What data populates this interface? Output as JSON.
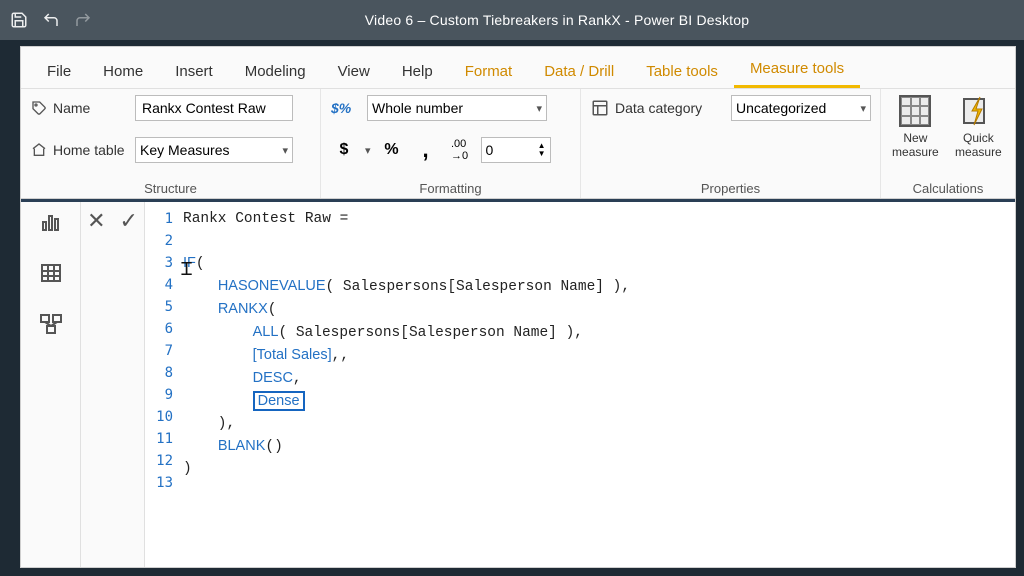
{
  "titlebar": {
    "title": "Video 6 – Custom Tiebreakers in RankX - Power BI Desktop"
  },
  "tabs": {
    "file": "File",
    "home": "Home",
    "insert": "Insert",
    "modeling": "Modeling",
    "view": "View",
    "help": "Help",
    "format": "Format",
    "data_drill": "Data / Drill",
    "table_tools": "Table tools",
    "measure_tools": "Measure tools"
  },
  "ribbon": {
    "structure": {
      "label": "Structure",
      "name_label": "Name",
      "name_value": "Rankx Contest Raw",
      "home_table_label": "Home table",
      "home_table_value": "Key Measures"
    },
    "formatting": {
      "label": "Formatting",
      "format_value": "Whole number",
      "decimals": "0",
      "currency_btn": "$",
      "percent_btn": "%",
      "comma_btn": ",",
      "decimal_btn": ".00→0"
    },
    "properties": {
      "label": "Properties",
      "data_category_label": "Data category",
      "data_category_value": "Uncategorized"
    },
    "calculations": {
      "label": "Calculations",
      "new_measure": "New measure",
      "quick_measure": "Quick measure"
    }
  },
  "editor": {
    "line_numbers": [
      "1",
      "2",
      "3",
      "4",
      "5",
      "6",
      "7",
      "8",
      "9",
      "10",
      "11",
      "12",
      "13"
    ],
    "measure_header": "Rankx Contest Raw =",
    "code_html": "Rankx Contest Raw =\n\n<span class=\"fn\">IF</span>(\n    <span class=\"fn\">HASONEVALUE</span>( Salespersons[Salesperson Name] ),\n    <span class=\"fn\">RANKX</span>(\n        <span class=\"fn\">ALL</span>( Salespersons[Salesperson Name] ),\n        <span class=\"ref\">[Total Sales]</span>,,\n        <span class=\"fn\">DESC</span>,\n        <span class=\"fn boxed\">Dense</span>\n    ),\n    <span class=\"fn\">BLANK</span>()\n)\n"
  }
}
